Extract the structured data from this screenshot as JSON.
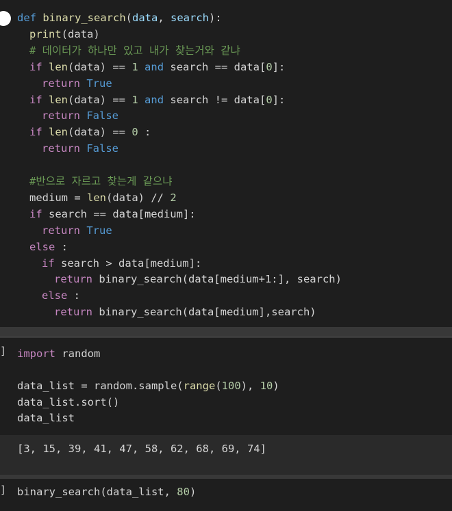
{
  "cell1": {
    "lines": [
      {
        "indent": 0,
        "tokens": [
          [
            "kw-blue",
            "def"
          ],
          [
            "plain",
            " "
          ],
          [
            "fn",
            "binary_search"
          ],
          [
            "plain",
            "("
          ],
          [
            "var",
            "data"
          ],
          [
            "plain",
            ", "
          ],
          [
            "var",
            "search"
          ],
          [
            "plain",
            "):"
          ]
        ]
      },
      {
        "indent": 1,
        "tokens": [
          [
            "fn",
            "print"
          ],
          [
            "plain",
            "("
          ],
          [
            "plain",
            "data"
          ],
          [
            "plain",
            ")"
          ]
        ]
      },
      {
        "indent": 1,
        "tokens": [
          [
            "cmt",
            "# 데이터가 하나만 있고 내가 찾는거와 같냐"
          ]
        ]
      },
      {
        "indent": 1,
        "tokens": [
          [
            "kw-purple",
            "if"
          ],
          [
            "plain",
            " "
          ],
          [
            "fn",
            "len"
          ],
          [
            "plain",
            "(data) == "
          ],
          [
            "num",
            "1"
          ],
          [
            "plain",
            " "
          ],
          [
            "kw-blue",
            "and"
          ],
          [
            "plain",
            " search == data["
          ],
          [
            "num",
            "0"
          ],
          [
            "plain",
            "]:"
          ]
        ]
      },
      {
        "indent": 2,
        "tokens": [
          [
            "kw-purple",
            "return"
          ],
          [
            "plain",
            " "
          ],
          [
            "kw-blue",
            "True"
          ]
        ]
      },
      {
        "indent": 1,
        "tokens": [
          [
            "kw-purple",
            "if"
          ],
          [
            "plain",
            " "
          ],
          [
            "fn",
            "len"
          ],
          [
            "plain",
            "(data) == "
          ],
          [
            "num",
            "1"
          ],
          [
            "plain",
            " "
          ],
          [
            "kw-blue",
            "and"
          ],
          [
            "plain",
            " search != data["
          ],
          [
            "num",
            "0"
          ],
          [
            "plain",
            "]:"
          ]
        ]
      },
      {
        "indent": 2,
        "tokens": [
          [
            "kw-purple",
            "return"
          ],
          [
            "plain",
            " "
          ],
          [
            "kw-blue",
            "False"
          ]
        ]
      },
      {
        "indent": 1,
        "tokens": [
          [
            "kw-purple",
            "if"
          ],
          [
            "plain",
            " "
          ],
          [
            "fn",
            "len"
          ],
          [
            "plain",
            "(data) == "
          ],
          [
            "num",
            "0"
          ],
          [
            "plain",
            " :"
          ]
        ]
      },
      {
        "indent": 2,
        "tokens": [
          [
            "kw-purple",
            "return"
          ],
          [
            "plain",
            " "
          ],
          [
            "kw-blue",
            "False"
          ]
        ]
      },
      {
        "indent": 0,
        "tokens": []
      },
      {
        "indent": 1,
        "tokens": [
          [
            "cmt",
            "#반으로 자르고 찾는게 같으냐"
          ]
        ]
      },
      {
        "indent": 1,
        "tokens": [
          [
            "plain",
            "medium = "
          ],
          [
            "fn",
            "len"
          ],
          [
            "plain",
            "(data) // "
          ],
          [
            "num",
            "2"
          ]
        ]
      },
      {
        "indent": 1,
        "tokens": [
          [
            "kw-purple",
            "if"
          ],
          [
            "plain",
            " search == data[medium]:"
          ]
        ]
      },
      {
        "indent": 2,
        "tokens": [
          [
            "kw-purple",
            "return"
          ],
          [
            "plain",
            " "
          ],
          [
            "kw-blue",
            "True"
          ]
        ]
      },
      {
        "indent": 1,
        "tokens": [
          [
            "kw-purple",
            "else"
          ],
          [
            "plain",
            " :"
          ]
        ]
      },
      {
        "indent": 2,
        "tokens": [
          [
            "kw-purple",
            "if"
          ],
          [
            "plain",
            " search > data[medium]:"
          ]
        ]
      },
      {
        "indent": 3,
        "tokens": [
          [
            "kw-purple",
            "return"
          ],
          [
            "plain",
            " binary_search(data[medium+1:], search)"
          ]
        ]
      },
      {
        "indent": 2,
        "tokens": [
          [
            "kw-purple",
            "else"
          ],
          [
            "plain",
            " :"
          ]
        ]
      },
      {
        "indent": 3,
        "tokens": [
          [
            "kw-purple",
            "return"
          ],
          [
            "plain",
            " binary_search(data[medium],search)"
          ]
        ]
      }
    ]
  },
  "cell2": {
    "gutter": "]",
    "lines": [
      {
        "indent": 0,
        "tokens": [
          [
            "kw-purple",
            "import"
          ],
          [
            "plain",
            " random"
          ]
        ]
      },
      {
        "indent": 0,
        "tokens": []
      },
      {
        "indent": 0,
        "tokens": [
          [
            "plain",
            "data_list = random.sample("
          ],
          [
            "fn",
            "range"
          ],
          [
            "plain",
            "("
          ],
          [
            "num",
            "100"
          ],
          [
            "plain",
            "), "
          ],
          [
            "num",
            "10"
          ],
          [
            "plain",
            ")"
          ]
        ]
      },
      {
        "indent": 0,
        "tokens": [
          [
            "plain",
            "data_list.sort()"
          ]
        ]
      },
      {
        "indent": 0,
        "tokens": [
          [
            "plain",
            "data_list"
          ]
        ]
      }
    ],
    "output": "[3, 15, 39, 41, 47, 58, 62, 68, 69, 74]"
  },
  "cell3": {
    "gutter": "]",
    "lines": [
      {
        "indent": 0,
        "tokens": [
          [
            "plain",
            "binary_search(data_list, "
          ],
          [
            "num",
            "80"
          ],
          [
            "plain",
            ")"
          ]
        ]
      }
    ]
  }
}
